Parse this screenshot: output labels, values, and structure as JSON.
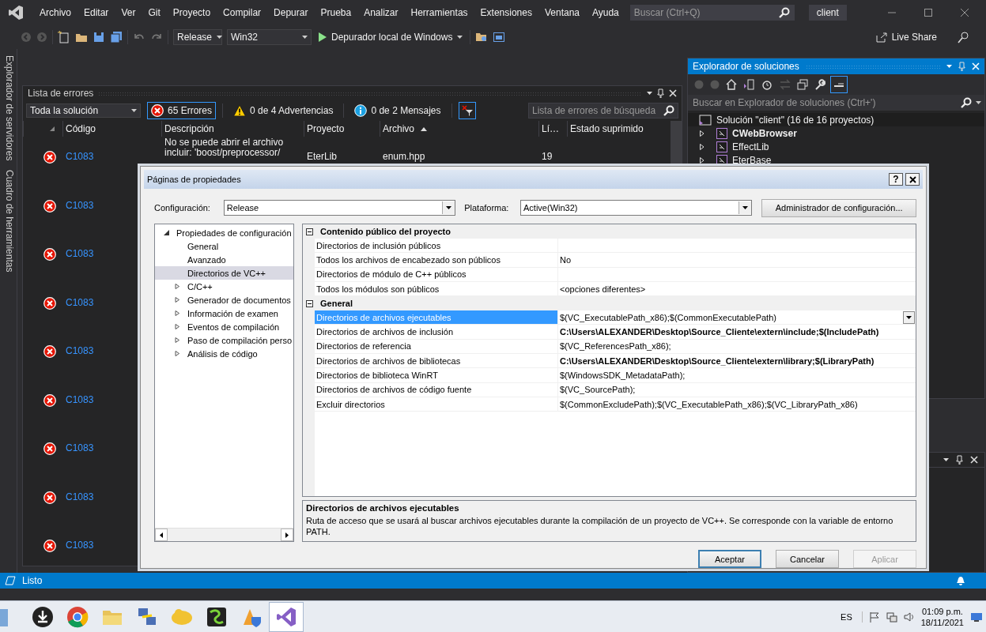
{
  "menu": {
    "items": [
      "Archivo",
      "Editar",
      "Ver",
      "Git",
      "Proyecto",
      "Compilar",
      "Depurar",
      "Prueba",
      "Analizar",
      "Herramientas",
      "Extensiones",
      "Ventana",
      "Ayuda"
    ],
    "search": {
      "placeholder": "Buscar (Ctrl+Q)"
    },
    "solution_name": "client"
  },
  "toolbar": {
    "configuration": "Release",
    "platform": "Win32",
    "debugger": "Depurador local de Windows",
    "live_share": "Live Share"
  },
  "side_tabs": [
    "Explorador de servidores",
    "Cuadro de herramientas"
  ],
  "error_list": {
    "title": "Lista de errores",
    "scope": "Toda la solución",
    "filters": [
      {
        "label": "65 Errores",
        "kind": "error",
        "selected": true
      },
      {
        "label": "0 de 4 Advertencias",
        "kind": "warning",
        "selected": false
      },
      {
        "label": "0 de 2 Mensajes",
        "kind": "info",
        "selected": false
      }
    ],
    "search": {
      "placeholder": "Lista de errores de búsqueda"
    },
    "columns": [
      {
        "label": "Código",
        "sort_ascending": false
      },
      {
        "label": "Descripción",
        "sort_ascending": false
      },
      {
        "label": "Proyecto",
        "sort_ascending": false
      },
      {
        "label": "Archivo",
        "sort_ascending": true
      },
      {
        "label": "Lí…",
        "sort_ascending": false
      },
      {
        "label": "Estado suprimido",
        "sort_ascending": false
      }
    ],
    "rows": [
      {
        "code": "C1083",
        "description": "No se puede abrir el archivo incluir: 'boost/preprocessor/",
        "project": "EterLib",
        "file": "enum.hpp",
        "line": "19"
      },
      {
        "code": "C1083"
      },
      {
        "code": "C1083"
      },
      {
        "code": "C1083"
      },
      {
        "code": "C1083"
      },
      {
        "code": "C1083"
      },
      {
        "code": "C1083"
      },
      {
        "code": "C1083"
      },
      {
        "code": "C1083"
      }
    ]
  },
  "solution_explorer": {
    "title": "Explorador de soluciones",
    "search": {
      "placeholder": "Buscar en Explorador de soluciones (Ctrl+')"
    },
    "root": "Solución \"client\" (16 de 16 proyectos)",
    "projects": [
      {
        "name": "CWebBrowser",
        "startup": true,
        "expanded": false
      },
      {
        "name": "EffectLib",
        "startup": false,
        "expanded": false
      },
      {
        "name": "EterBase",
        "startup": false,
        "expanded": false
      }
    ]
  },
  "dialog": {
    "title": "Páginas de propiedades",
    "help_button": "?",
    "configuration_label": "Configuración:",
    "configuration": "Release",
    "platform_label": "Plataforma:",
    "platform": "Active(Win32)",
    "manager_button": "Administrador de configuración...",
    "tree": [
      {
        "label": "Propiedades de configuración",
        "expandable": true,
        "expanded": true,
        "selected": false,
        "children": [
          {
            "label": "General",
            "expandable": false,
            "selected": false
          },
          {
            "label": "Avanzado",
            "expandable": false,
            "selected": false
          },
          {
            "label": "Directorios de VC++",
            "expandable": false,
            "selected": true
          },
          {
            "label": "C/C++",
            "expandable": true,
            "expanded": false,
            "selected": false
          },
          {
            "label": "Generador de documentos",
            "expandable": true,
            "expanded": false,
            "selected": false
          },
          {
            "label": "Información de examen",
            "expandable": true,
            "expanded": false,
            "selected": false
          },
          {
            "label": "Eventos de compilación",
            "expandable": true,
            "expanded": false,
            "selected": false
          },
          {
            "label": "Paso de compilación perso",
            "expandable": true,
            "expanded": false,
            "selected": false
          },
          {
            "label": "Análisis de código",
            "expandable": true,
            "expanded": false,
            "selected": false
          }
        ]
      }
    ],
    "sections": [
      {
        "title": "Contenido público del proyecto",
        "expanded": true,
        "properties": [
          {
            "name": "Directorios de inclusión públicos",
            "selected": false
          },
          {
            "name": "Todos los archivos de encabezado son públicos",
            "value": "No",
            "bold": false,
            "selected": false
          },
          {
            "name": "Directorios de módulo de C++ públicos",
            "selected": false
          },
          {
            "name": "Todos los módulos son públicos",
            "value": "<opciones diferentes>",
            "bold": false,
            "selected": false
          }
        ]
      },
      {
        "title": "General",
        "expanded": true,
        "properties": [
          {
            "name": "Directorios de archivos ejecutables",
            "value": "$(VC_ExecutablePath_x86);$(CommonExecutablePath)",
            "bold": false,
            "selected": true
          },
          {
            "name": "Directorios de archivos de inclusión",
            "value": "C:\\Users\\ALEXANDER\\Desktop\\Source_Cliente\\extern\\include;$(IncludePath)",
            "bold": true,
            "selected": false
          },
          {
            "name": "Directorios de referencia",
            "value": "$(VC_ReferencesPath_x86);",
            "bold": false,
            "selected": false
          },
          {
            "name": "Directorios de archivos de bibliotecas",
            "value": "C:\\Users\\ALEXANDER\\Desktop\\Source_Cliente\\extern\\library;$(LibraryPath)",
            "bold": true,
            "selected": false
          },
          {
            "name": "Directorios de biblioteca WinRT",
            "value": "$(WindowsSDK_MetadataPath);",
            "bold": false,
            "selected": false
          },
          {
            "name": "Directorios de archivos de código fuente",
            "value": "$(VC_SourcePath);",
            "bold": false,
            "selected": false
          },
          {
            "name": "Excluir directorios",
            "value": "$(CommonExcludePath);$(VC_ExecutablePath_x86);$(VC_LibraryPath_x86)",
            "bold": false,
            "selected": false
          }
        ]
      }
    ],
    "description": {
      "title": "Directorios de archivos ejecutables",
      "text": "Ruta de acceso que se usará al buscar archivos ejecutables durante la compilación de un proyecto de VC++.  Se corresponde con la variable de entorno PATH."
    },
    "buttons": [
      {
        "label": "Aceptar",
        "default": true,
        "disabled": false
      },
      {
        "label": "Cancelar",
        "default": false,
        "disabled": false
      },
      {
        "label": "Aplicar",
        "default": false,
        "disabled": true
      }
    ]
  },
  "status_bar": {
    "text": "Listo"
  },
  "taskbar": {
    "language": "ES",
    "time": "01:09 p.m.",
    "date": "18/11/2021"
  }
}
